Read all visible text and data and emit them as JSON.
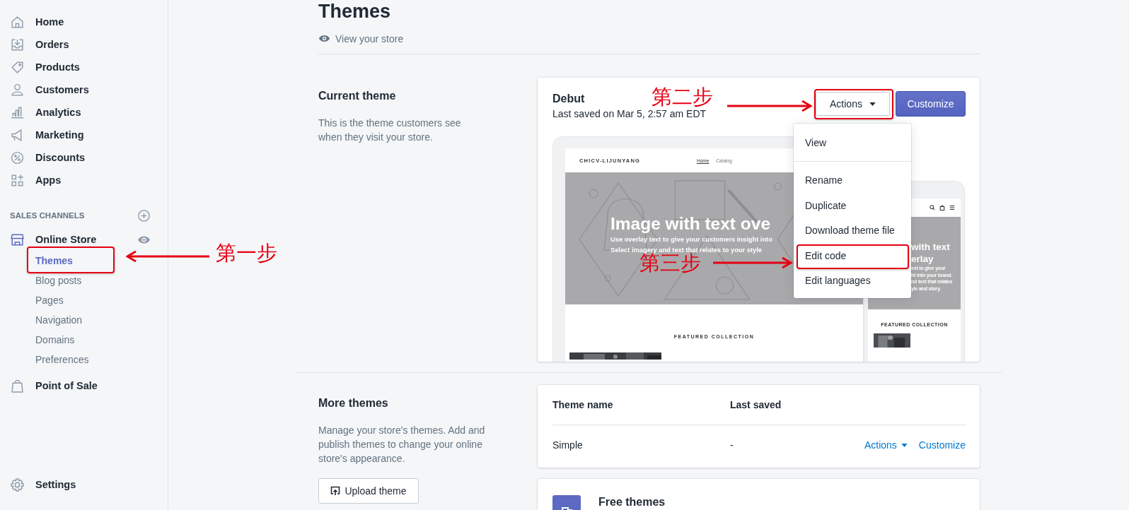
{
  "sidebar": {
    "items": [
      {
        "label": "Home"
      },
      {
        "label": "Orders"
      },
      {
        "label": "Products"
      },
      {
        "label": "Customers"
      },
      {
        "label": "Analytics"
      },
      {
        "label": "Marketing"
      },
      {
        "label": "Discounts"
      },
      {
        "label": "Apps"
      }
    ],
    "channels_heading": "SALES CHANNELS",
    "channels": [
      {
        "label": "Online Store",
        "children": [
          {
            "label": "Themes",
            "selected": true
          },
          {
            "label": "Blog posts",
            "selected": false
          },
          {
            "label": "Pages",
            "selected": false
          },
          {
            "label": "Navigation",
            "selected": false
          },
          {
            "label": "Domains",
            "selected": false
          },
          {
            "label": "Preferences",
            "selected": false
          }
        ]
      },
      {
        "label": "Point of Sale"
      }
    ],
    "settings": "Settings"
  },
  "page": {
    "title": "Themes",
    "view_store": "View your store"
  },
  "current_theme": {
    "heading": "Current theme",
    "description": "This is the theme customers see when they visit your store.",
    "name": "Debut",
    "last_saved": "Last saved on Mar 5, 2:57 am EDT",
    "actions_button": "Actions",
    "customize_button": "Customize",
    "preview": {
      "store_name": "CHICV-LIJUNYANG",
      "nav": [
        {
          "label": "Home",
          "selected": true
        },
        {
          "label": "Catalog",
          "selected": false
        }
      ],
      "hero_title": "Image with text ove",
      "hero_lines": [
        "Use overlay text to give your customers insight into",
        "Select imagery and text that relates to your style"
      ],
      "featured": "FEATURED COLLECTION",
      "mobile_hero_title": [
        "with text",
        "erlay"
      ],
      "mobile_hero_lines": [
        "ext to give your",
        "ht into your brand.",
        "nd text that relates",
        "yle and story."
      ],
      "mobile_featured": "FEATURED COLLECTION"
    },
    "menu": [
      [
        "View"
      ],
      [
        "Rename",
        "Duplicate",
        "Download theme file",
        "Edit code",
        "Edit languages"
      ]
    ]
  },
  "more_themes": {
    "heading": "More themes",
    "description": "Manage your store's themes. Add and publish themes to change your online store's appearance.",
    "upload_button": "Upload theme",
    "table": {
      "columns": [
        "Theme name",
        "Last saved"
      ],
      "rows": [
        {
          "name": "Simple",
          "last_saved": "-",
          "actions": "Actions",
          "customize": "Customize"
        }
      ]
    }
  },
  "free_themes": {
    "title": "Free themes"
  },
  "annotations": [
    {
      "label": "第一步"
    },
    {
      "label": "第二步"
    },
    {
      "label": "第三步"
    }
  ]
}
